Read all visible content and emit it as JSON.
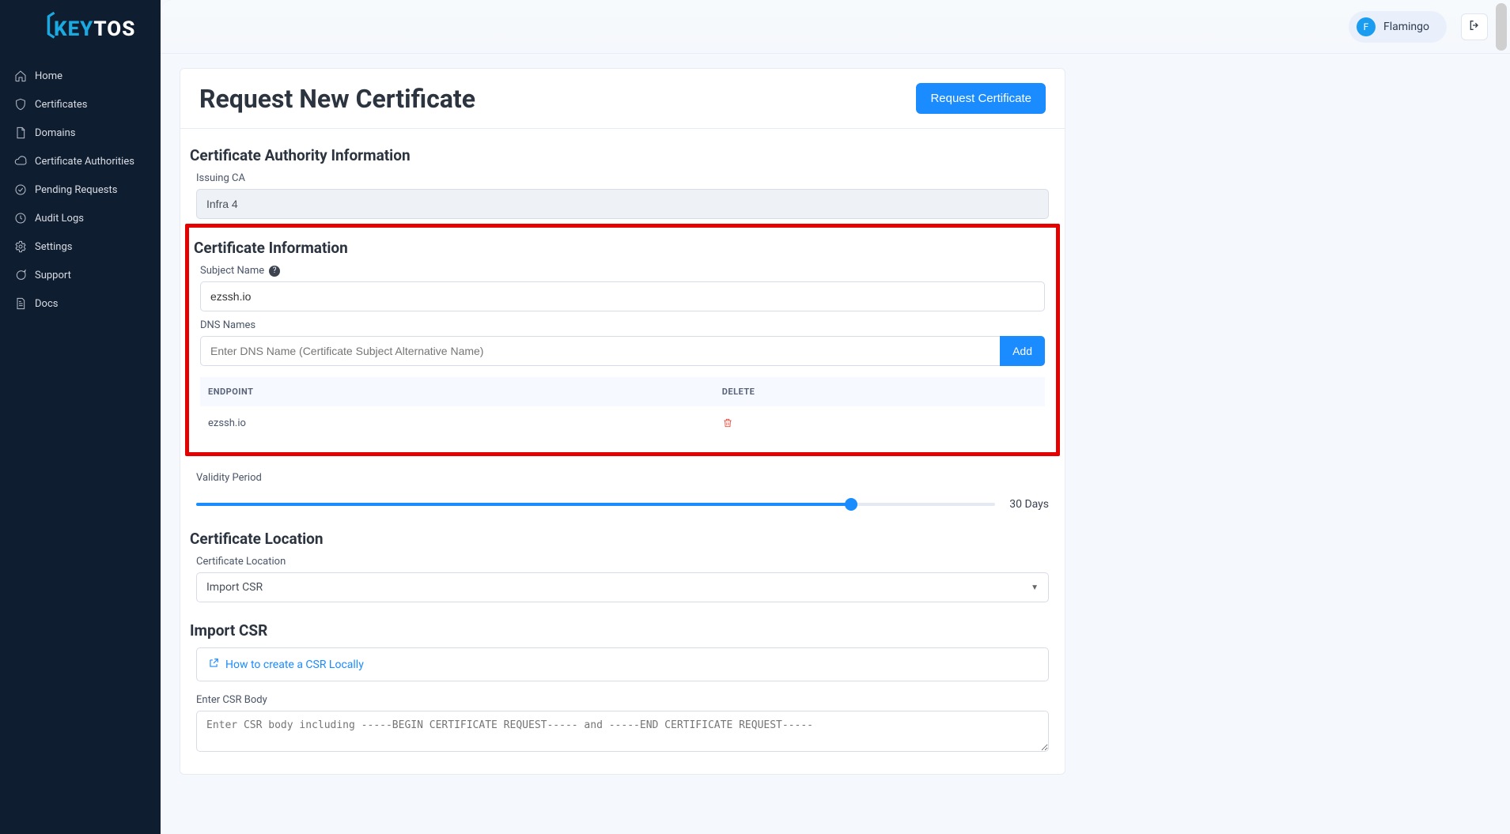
{
  "brand": {
    "key": "KEY",
    "tos": "TOS"
  },
  "sidebar": {
    "items": [
      {
        "label": "Home"
      },
      {
        "label": "Certificates"
      },
      {
        "label": "Domains"
      },
      {
        "label": "Certificate Authorities"
      },
      {
        "label": "Pending Requests"
      },
      {
        "label": "Audit Logs"
      },
      {
        "label": "Settings"
      },
      {
        "label": "Support"
      },
      {
        "label": "Docs"
      }
    ]
  },
  "user": {
    "initial": "F",
    "name": "Flamingo"
  },
  "page": {
    "title": "Request New Certificate",
    "request_button": "Request Certificate"
  },
  "ca_info": {
    "section_title": "Certificate Authority Information",
    "issuing_ca_label": "Issuing CA",
    "issuing_ca_value": "Infra 4"
  },
  "cert_info": {
    "section_title": "Certificate Information",
    "subject_label": "Subject Name",
    "subject_value": "ezssh.io",
    "dns_label": "DNS Names",
    "dns_placeholder": "Enter DNS Name (Certificate Subject Alternative Name)",
    "add_button": "Add",
    "columns": {
      "endpoint": "ENDPOINT",
      "delete": "DELETE"
    },
    "rows": [
      {
        "endpoint": "ezssh.io"
      }
    ]
  },
  "validity": {
    "label": "Validity Period",
    "value_label": "30 Days"
  },
  "location": {
    "section_title": "Certificate Location",
    "field_label": "Certificate Location",
    "selected": "Import CSR"
  },
  "import_csr": {
    "section_title": "Import CSR",
    "link_text": "How to create a CSR Locally",
    "body_label": "Enter CSR Body",
    "body_placeholder": "Enter CSR body including -----BEGIN CERTIFICATE REQUEST----- and -----END CERTIFICATE REQUEST-----"
  }
}
